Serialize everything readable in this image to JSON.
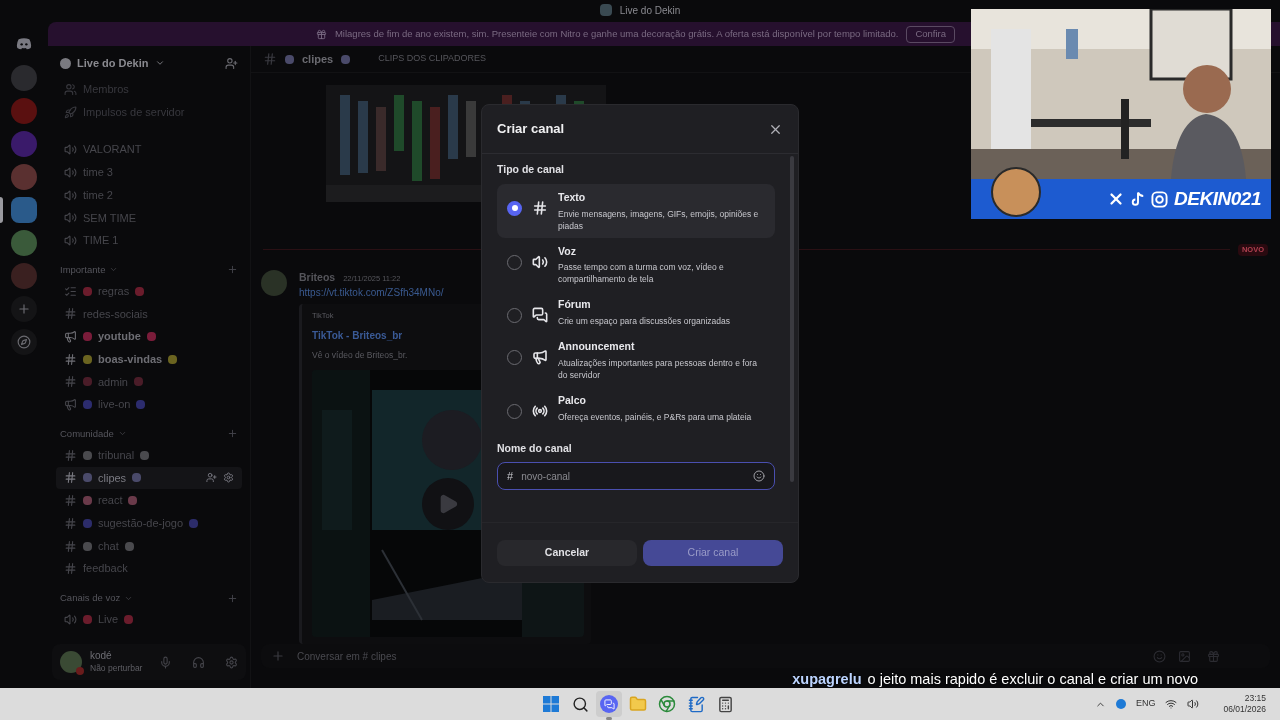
{
  "window": {
    "title": "Live do Dekin"
  },
  "banner": {
    "text": "Milagres de fim de ano existem, sim. Presenteie com Nitro e ganhe uma decoração grátis. A oferta está disponível por tempo limitado.",
    "button": "Confira"
  },
  "servers": [
    {
      "selected": false
    },
    {
      "selected": false
    },
    {
      "selected": false
    },
    {
      "selected": false
    },
    {
      "selected": true
    },
    {
      "selected": false
    },
    {
      "selected": false
    }
  ],
  "sidebar": {
    "server_name": "Live do Dekin",
    "links": [
      {
        "kind": "members",
        "label": "Membros"
      },
      {
        "kind": "boosts",
        "label": "Impulsos de servidor"
      }
    ],
    "channels": [
      {
        "kind": "voice",
        "name": "VALORANT",
        "selected": false,
        "unread": false
      },
      {
        "kind": "voice",
        "name": "time 3",
        "selected": false,
        "unread": false
      },
      {
        "kind": "voice",
        "name": "time 2",
        "selected": false,
        "unread": false
      },
      {
        "kind": "voice",
        "name": "SEM TIME",
        "selected": false,
        "unread": false
      },
      {
        "kind": "voice",
        "name": "TIME 1",
        "selected": false,
        "unread": false
      }
    ],
    "categories": [
      {
        "name": "Importante",
        "channels": [
          {
            "kind": "rules",
            "name": "regras",
            "selected": false,
            "unread": false,
            "color": "#6b1c2c"
          },
          {
            "kind": "text",
            "name": "redes-sociais",
            "selected": false,
            "unread": false
          },
          {
            "kind": "announcement",
            "name": "youtube",
            "selected": false,
            "unread": true,
            "color": "#7a1c3a"
          },
          {
            "kind": "text",
            "name": "boas-vindas",
            "selected": false,
            "unread": true,
            "color": "#6b6420"
          },
          {
            "kind": "text",
            "name": "admin",
            "selected": false,
            "unread": false,
            "color": "#4a1c28"
          },
          {
            "kind": "announcement",
            "name": "live-on",
            "selected": false,
            "unread": false,
            "color": "#2c2c6e"
          }
        ]
      },
      {
        "name": "Comunidade",
        "channels": [
          {
            "kind": "text",
            "name": "tribunal",
            "selected": false,
            "unread": false,
            "color": "#4a4a4e"
          },
          {
            "kind": "text",
            "name": "clipes",
            "selected": true,
            "unread": false,
            "color": "#4a4a6a"
          },
          {
            "kind": "text",
            "name": "react",
            "selected": false,
            "unread": false,
            "color": "#6a3a4a"
          },
          {
            "kind": "text",
            "name": "sugestão-de-jogo",
            "selected": false,
            "unread": false,
            "color": "#2c2c6a"
          },
          {
            "kind": "text",
            "name": "chat",
            "selected": false,
            "unread": false,
            "color": "#4a4a4e"
          },
          {
            "kind": "text",
            "name": "feedback",
            "selected": false,
            "unread": false
          }
        ]
      },
      {
        "name": "Canais de voz",
        "channels": [
          {
            "kind": "voice",
            "name": "Live",
            "selected": false,
            "unread": false,
            "color": "#6b1c2c"
          }
        ]
      }
    ]
  },
  "user": {
    "name": "kodé",
    "status": "Não perturbar"
  },
  "chat": {
    "channel": "clipes",
    "topic": "CLIPS DOS CLIPADORES",
    "new_label": "NOVO",
    "message": {
      "author": "Briteos",
      "time": "22/11/2025 11:22",
      "link": "https://vt.tiktok.com/ZSfh34MNo/",
      "embed": {
        "provider": "TikTok",
        "title": "TikTok - Briteos_br",
        "description": "Vê o vídeo de Briteos_br."
      }
    },
    "input_placeholder": "Conversar em # clipes"
  },
  "dialog": {
    "title": "Criar canal",
    "section": "Tipo de canal",
    "types": [
      {
        "kind": "text",
        "name": "Texto",
        "description": "Envie mensagens, imagens, GIFs, emojis, opiniões e piadas",
        "selected": true
      },
      {
        "kind": "voice",
        "name": "Voz",
        "description": "Passe tempo com a turma com voz, vídeo e compartilhamento de tela",
        "selected": false
      },
      {
        "kind": "forum",
        "name": "Fórum",
        "description": "Crie um espaço para discussões organizadas",
        "selected": false
      },
      {
        "kind": "announcement",
        "name": "Announcement",
        "description": "Atualizações importantes para pessoas dentro e fora do servidor",
        "selected": false
      },
      {
        "kind": "stage",
        "name": "Palco",
        "description": "Ofereça eventos, painéis, e P&Rs para uma plateia",
        "selected": false
      }
    ],
    "name_label": "Nome do canal",
    "name_prefix": "#",
    "name_placeholder": "novo-canal",
    "cancel": "Cancelar",
    "create": "Criar canal",
    "create_disabled": true
  },
  "stream_overlay": {
    "handle": "DEKIN021"
  },
  "stream_chat": {
    "user": "xupagrelu",
    "message": "o jeito mais rapido é excluir o canal e criar um novo"
  },
  "taskbar": {
    "apps": [
      {
        "kind": "start",
        "selected": false
      },
      {
        "kind": "search",
        "selected": false
      },
      {
        "kind": "discord",
        "selected": true
      },
      {
        "kind": "files",
        "selected": false
      },
      {
        "kind": "browser",
        "selected": false
      },
      {
        "kind": "notepad",
        "selected": false
      },
      {
        "kind": "calculator",
        "selected": false
      }
    ],
    "language": "ENG",
    "time": "23:15",
    "date": "06/01/2026"
  }
}
